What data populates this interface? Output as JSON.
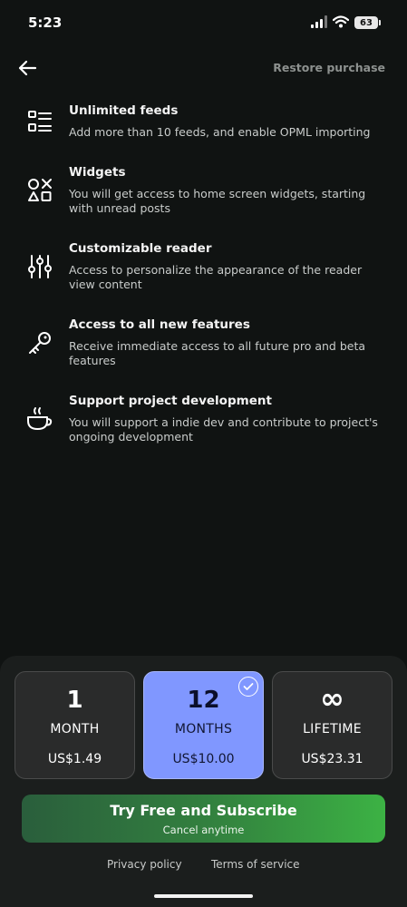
{
  "status_bar": {
    "time": "5:23",
    "battery": "63"
  },
  "header": {
    "restore_label": "Restore purchase"
  },
  "features": [
    {
      "icon": "list-icon",
      "title": "Unlimited feeds",
      "description": "Add more than 10 feeds, and enable OPML importing"
    },
    {
      "icon": "shapes-icon",
      "title": "Widgets",
      "description": "You will get access to home screen widgets, starting with unread posts"
    },
    {
      "icon": "sliders-icon",
      "title": "Customizable reader",
      "description": "Access to personalize the appearance of the reader view content"
    },
    {
      "icon": "key-icon",
      "title": "Access to all new features",
      "description": "Receive immediate access to all future pro and beta features"
    },
    {
      "icon": "coffee-icon",
      "title": "Support project development",
      "description": "You will support a indie dev and contribute to project's ongoing development"
    }
  ],
  "plans": [
    {
      "quantity": "1",
      "unit": "MONTH",
      "price": "US$1.49",
      "selected": false
    },
    {
      "quantity": "12",
      "unit": "MONTHS",
      "price": "US$10.00",
      "selected": true
    },
    {
      "quantity": "∞",
      "unit": "LIFETIME",
      "price": "US$23.31",
      "selected": false
    }
  ],
  "subscribe": {
    "label": "Try Free and Subscribe",
    "sublabel": "Cancel anytime"
  },
  "legal": {
    "privacy": "Privacy policy",
    "terms": "Terms of service"
  },
  "colors": {
    "background": "#101312",
    "selected_plan": "#8097ff",
    "subscribe_start": "#2a5e3c",
    "subscribe_end": "#3cb244"
  }
}
